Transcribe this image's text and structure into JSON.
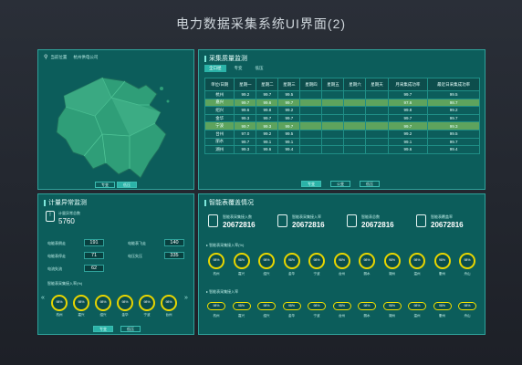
{
  "page_title": "电力数据采集系统UI界面(2)",
  "map_panel": {
    "location": "当前位置",
    "company": "杭州供电公司",
    "tabs": [
      "专变",
      "低压"
    ]
  },
  "quality": {
    "title": "采集质量监测",
    "tabs": [
      "全口径",
      "专变",
      "低压"
    ],
    "table_headers": [
      "单位/日期",
      "星期一",
      "星期二",
      "星期三",
      "星期四",
      "星期五",
      "星期六",
      "星期天",
      "月采集成功率",
      "最近日采集成功率"
    ],
    "rows": [
      [
        "杭州",
        "99.2",
        "99.7",
        "99.5",
        "",
        "",
        "",
        "",
        "99.7",
        "99.5"
      ],
      [
        "嘉兴",
        "99.7",
        "99.6",
        "99.7",
        "",
        "",
        "",
        "",
        "97.6",
        "98.7"
      ],
      [
        "绍兴",
        "99.6",
        "99.8",
        "99.2",
        "",
        "",
        "",
        "",
        "99.8",
        "99.2"
      ],
      [
        "金华",
        "99.3",
        "99.7",
        "99.7",
        "",
        "",
        "",
        "",
        "99.7",
        "99.7"
      ],
      [
        "宁波",
        "99.7",
        "99.3",
        "99.7",
        "",
        "",
        "",
        "",
        "99.7",
        "99.3"
      ],
      [
        "台州",
        "97.0",
        "99.2",
        "99.5",
        "",
        "",
        "",
        "",
        "99.2",
        "99.5"
      ],
      [
        "丽水",
        "99.7",
        "99.1",
        "99.1",
        "",
        "",
        "",
        "",
        "99.1",
        "99.7"
      ],
      [
        "湖州",
        "99.3",
        "99.6",
        "99.4",
        "",
        "",
        "",
        "",
        "99.6",
        "99.4"
      ]
    ],
    "bottom_tabs": [
      "专变",
      "公变",
      "低压"
    ],
    "highlight_rows": [
      1,
      4
    ]
  },
  "abnormal": {
    "title": "计量异常监测",
    "total_label": "计量异常总数",
    "total": "5760",
    "metrics": [
      {
        "label": "电能表倒走",
        "value": "191"
      },
      {
        "label": "电能表飞走",
        "value": "140"
      },
      {
        "label": "电能表停走",
        "value": "71"
      },
      {
        "label": "电压失压",
        "value": "335"
      },
      {
        "label": "电流失流",
        "value": "62"
      }
    ],
    "rate_title": "智能表采集接入率(%)",
    "rings": [
      {
        "city": "杭州",
        "value": "98%"
      },
      {
        "city": "嘉兴",
        "value": "98%"
      },
      {
        "city": "绍兴",
        "value": "98%"
      },
      {
        "city": "金华",
        "value": "98%"
      },
      {
        "city": "宁波",
        "value": "98%"
      },
      {
        "city": "台州",
        "value": "98%"
      }
    ],
    "bottom_tabs": [
      "专变",
      "低压"
    ]
  },
  "smart": {
    "title": "智能表覆盖情况",
    "stats": [
      {
        "label": "智能表采集接入数",
        "value": "20672816"
      },
      {
        "label": "智能表采集接入率",
        "value": "20672816"
      },
      {
        "label": "智能表总数",
        "value": "20672816"
      },
      {
        "label": "智能表覆盖率",
        "value": "20672816"
      }
    ],
    "rate1_title": "智能表采集接入率(%)",
    "rate2_title": "智能表采集接入率",
    "cities": [
      "杭州",
      "嘉兴",
      "绍兴",
      "金华",
      "宁波",
      "台州",
      "丽水",
      "湖州",
      "温州",
      "衢州",
      "舟山"
    ],
    "ring_value": "98%",
    "pill_value": "98%"
  }
}
